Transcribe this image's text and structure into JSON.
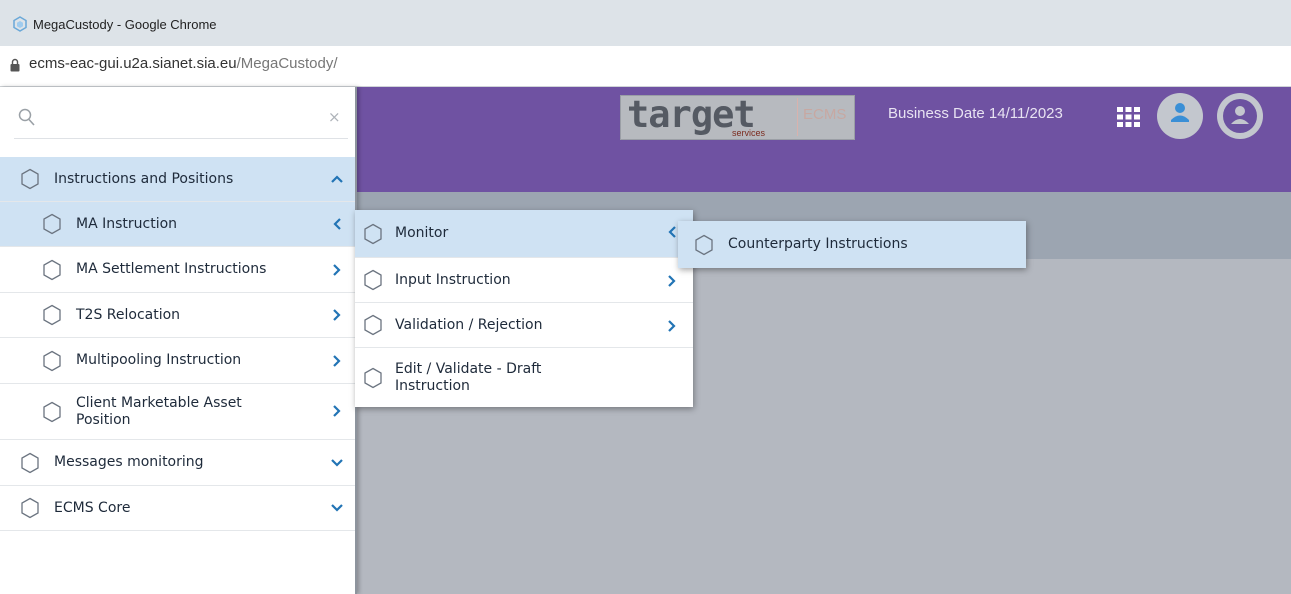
{
  "browser": {
    "window_title": "MegaCustody - Google Chrome",
    "url_host": "ecms-eac-gui.u2a.sianet.sia.eu",
    "url_path": "/MegaCustody/"
  },
  "header": {
    "logo_text": "target",
    "logo_subtext": "services",
    "logo_product": "ECMS",
    "business_date": "Business Date 14/11/2023",
    "icons": [
      "apps-grid-icon",
      "user-circle-icon",
      "user-profile-icon"
    ],
    "brand_color": "#6f52a2"
  },
  "sidebar": {
    "search_placeholder": "",
    "clear_icon": "×",
    "items": [
      {
        "label": "Instructions and Positions",
        "level": 0,
        "state": "expanded"
      },
      {
        "label": "MA Instruction",
        "level": 1,
        "state": "open-flyout"
      },
      {
        "label": "MA Settlement Instructions",
        "level": 1,
        "state": "collapsed"
      },
      {
        "label": "T2S Relocation",
        "level": 1,
        "state": "collapsed"
      },
      {
        "label": "Multipooling Instruction",
        "level": 1,
        "state": "collapsed"
      },
      {
        "label": "Client Marketable Asset Position",
        "level": 1,
        "state": "collapsed"
      },
      {
        "label": "Messages monitoring",
        "level": 0,
        "state": "collapsed"
      },
      {
        "label": "ECMS Core",
        "level": 0,
        "state": "collapsed"
      }
    ]
  },
  "submenu_1": {
    "items": [
      {
        "label": "Monitor",
        "state": "open-flyout"
      },
      {
        "label": "Input Instruction",
        "state": "collapsed"
      },
      {
        "label": "Validation / Rejection",
        "state": "collapsed"
      },
      {
        "label": "Edit / Validate - Draft Instruction",
        "state": "leaf"
      }
    ]
  },
  "submenu_2": {
    "items": [
      {
        "label": "Counterparty Instructions"
      }
    ]
  },
  "colors": {
    "selected_row": "#cfe2f3",
    "chevron": "#2274b5",
    "content_bg": "#b4b8c0"
  }
}
